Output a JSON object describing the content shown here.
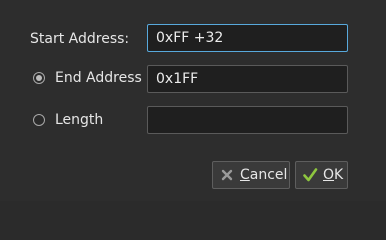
{
  "dialog": {
    "start_address": {
      "label": "Start Address:",
      "value": "0xFF +32"
    },
    "end_address": {
      "label": "End Address",
      "value": "0x1FF",
      "selected": true
    },
    "length": {
      "label": "Length",
      "value": "",
      "selected": false
    },
    "buttons": {
      "cancel": {
        "mnemonic": "C",
        "rest": "ancel",
        "icon": "cancel-x-icon"
      },
      "ok": {
        "mnemonic": "O",
        "rest": "K",
        "icon": "checkmark-icon"
      }
    }
  },
  "colors": {
    "background": "#2d2d2d",
    "field_background": "#1f1f1f",
    "focus_border": "#58a9dc",
    "ok_check_green": "#8ec63f"
  }
}
